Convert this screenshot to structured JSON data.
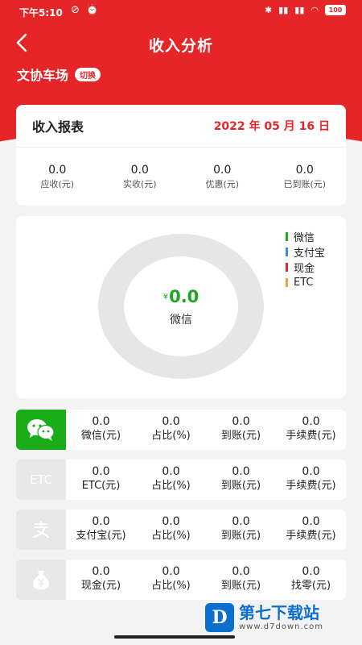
{
  "status_bar": {
    "time": "下午5:10",
    "battery": "100"
  },
  "header": {
    "title": "收入分析",
    "back_icon": "chevron-left-icon",
    "lot_name": "文协车场",
    "switch_label": "切换"
  },
  "report": {
    "title": "收入报表",
    "date": "2022 年 05 月 16 日",
    "stats": [
      {
        "value": "0.0",
        "label": "应收(元)"
      },
      {
        "value": "0.0",
        "label": "实收(元)"
      },
      {
        "value": "0.0",
        "label": "优惠(元)"
      },
      {
        "value": "0.0",
        "label": "已到账(元)"
      }
    ]
  },
  "chart": {
    "legend": [
      {
        "name": "微信",
        "color": "#1aac19"
      },
      {
        "name": "支付宝",
        "color": "#3f86e8"
      },
      {
        "name": "现金",
        "color": "#e52527"
      },
      {
        "name": "ETC",
        "color": "#f0a040"
      }
    ],
    "currency_symbol": "¥",
    "center_value": "0.0",
    "center_label": "微信"
  },
  "methods": [
    {
      "icon": "wechat-icon",
      "cols": [
        {
          "value": "0.0",
          "label": "微信(元)"
        },
        {
          "value": "0.0",
          "label": "占比(%)"
        },
        {
          "value": "0.0",
          "label": "到账(元)"
        },
        {
          "value": "0.0",
          "label": "手续费(元)"
        }
      ]
    },
    {
      "icon": "etc-icon",
      "icon_text": "ETC",
      "cols": [
        {
          "value": "0.0",
          "label": "ETC(元)"
        },
        {
          "value": "0.0",
          "label": "占比(%)"
        },
        {
          "value": "0.0",
          "label": "到账(元)"
        },
        {
          "value": "0.0",
          "label": "手续费(元)"
        }
      ]
    },
    {
      "icon": "alipay-icon",
      "cols": [
        {
          "value": "0.0",
          "label": "支付宝(元)"
        },
        {
          "value": "0.0",
          "label": "占比(%)"
        },
        {
          "value": "0.0",
          "label": "到账(元)"
        },
        {
          "value": "0.0",
          "label": "手续费(元)"
        }
      ]
    },
    {
      "icon": "money-bag-icon",
      "cols": [
        {
          "value": "0.0",
          "label": "现金(元)"
        },
        {
          "value": "0.0",
          "label": "占比(%)"
        },
        {
          "value": "0.0",
          "label": "到账(元)"
        },
        {
          "value": "0.0",
          "label": "找零(元)"
        }
      ]
    }
  ],
  "watermark": {
    "logo_letter": "D",
    "name": "第七下载站",
    "url": "www.d7down.com"
  }
}
